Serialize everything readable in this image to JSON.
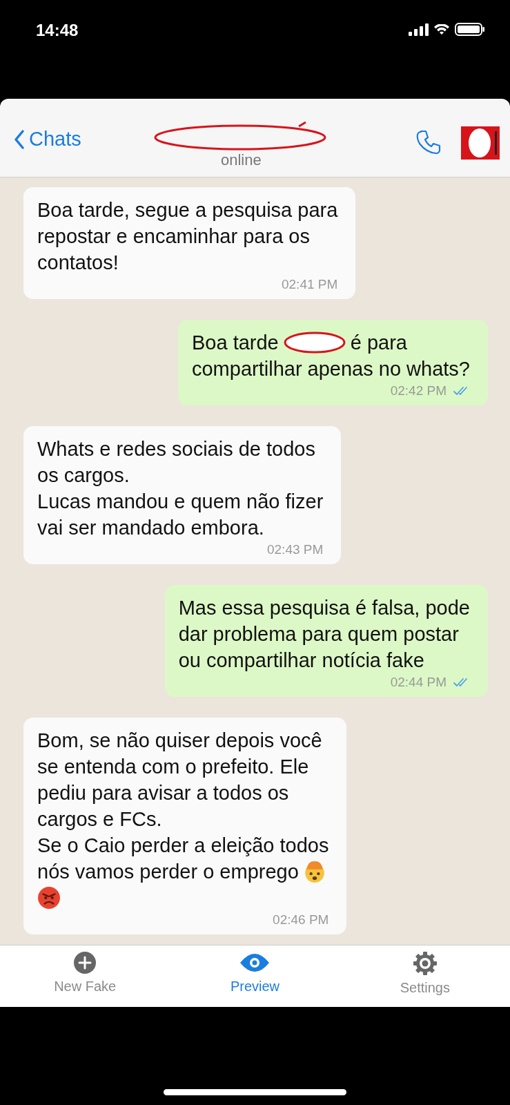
{
  "status_bar": {
    "time": "14:48"
  },
  "header": {
    "back_label": "Chats",
    "presence": "online"
  },
  "messages": [
    {
      "kind": "incoming",
      "lines": [
        [
          {
            "kind": "text",
            "text": "Boa tarde, segue a pesquisa para"
          }
        ],
        [
          {
            "kind": "text",
            "text": "repostar e encaminhar para os"
          }
        ],
        [
          {
            "kind": "text",
            "text": "contatos!"
          }
        ]
      ],
      "time": "02:41 PM"
    },
    {
      "kind": "outgoing",
      "lines": [
        [
          {
            "kind": "text",
            "text": "Boa tarde"
          },
          {
            "kind": "redaction"
          },
          {
            "kind": "text",
            "text": "é para"
          }
        ],
        [
          {
            "kind": "text",
            "text": "compartilhar apenas no whats?"
          }
        ]
      ],
      "time": "02:42 PM",
      "read": true
    },
    {
      "kind": "incoming",
      "lines": [
        [
          {
            "kind": "text",
            "text": "Whats e redes sociais de todos"
          }
        ],
        [
          {
            "kind": "text",
            "text": "os cargos."
          }
        ],
        [
          {
            "kind": "text",
            "text": "Lucas mandou e quem não fizer"
          }
        ],
        [
          {
            "kind": "text",
            "text": "vai ser mandado embora."
          }
        ]
      ],
      "time": "02:43 PM"
    },
    {
      "kind": "outgoing",
      "lines": [
        [
          {
            "kind": "text",
            "text": "Mas essa pesquisa é falsa, pode"
          }
        ],
        [
          {
            "kind": "text",
            "text": "dar problema para quem postar"
          }
        ],
        [
          {
            "kind": "text",
            "text": "ou compartilhar notícia fake"
          }
        ]
      ],
      "time": "02:44 PM",
      "read": true
    },
    {
      "kind": "incoming",
      "lines": [
        [
          {
            "kind": "text",
            "text": "Bom, se não quiser depois você"
          }
        ],
        [
          {
            "kind": "text",
            "text": "se entenda com o prefeito. Ele"
          }
        ],
        [
          {
            "kind": "text",
            "text": "pediu para avisar a todos os"
          }
        ],
        [
          {
            "kind": "text",
            "text": "cargos e FCs."
          }
        ],
        [
          {
            "kind": "text",
            "text": "Se o Caio perder a eleição todos"
          }
        ],
        [
          {
            "kind": "text",
            "text": "nós vamos perder o emprego"
          },
          {
            "kind": "exploding-head"
          }
        ],
        [
          {
            "kind": "angry-face"
          }
        ]
      ],
      "time": "02:46 PM"
    }
  ],
  "tabs": [
    {
      "label": "New Fake",
      "kind": "plus",
      "selected": false
    },
    {
      "label": "Preview",
      "kind": "eye",
      "selected": true
    },
    {
      "label": "Settings",
      "kind": "gear",
      "selected": false
    }
  ]
}
